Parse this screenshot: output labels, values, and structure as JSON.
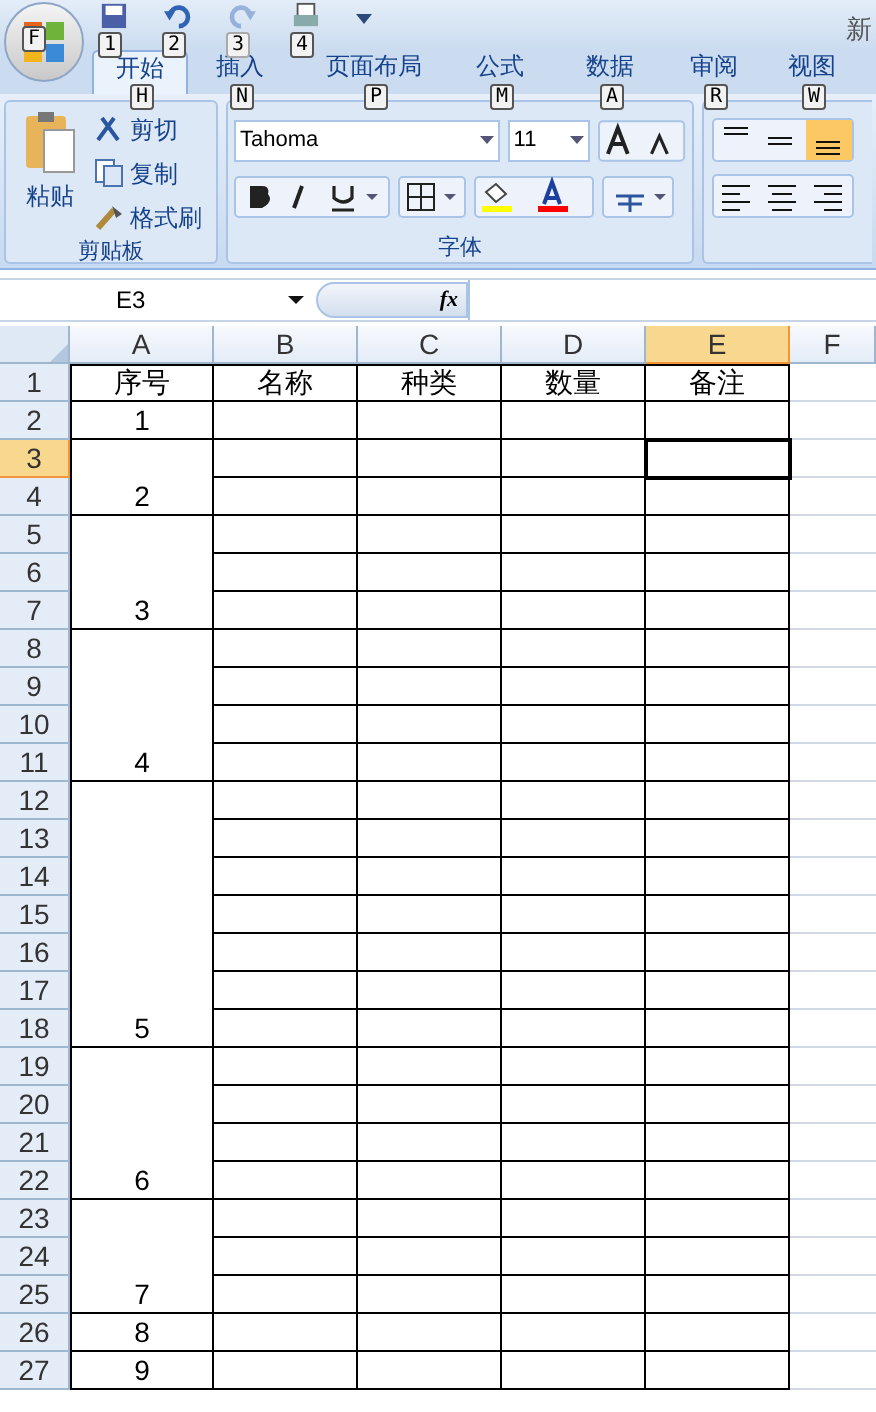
{
  "window": {
    "title": "新"
  },
  "office_button": {
    "keytip": "F"
  },
  "quick_access": [
    {
      "kind": "save",
      "keytip": "1",
      "disabled": false
    },
    {
      "kind": "undo",
      "keytip": "2",
      "disabled": false
    },
    {
      "kind": "redo",
      "keytip": "3",
      "disabled": true
    },
    {
      "kind": "print",
      "keytip": "4",
      "disabled": false
    }
  ],
  "tabs": [
    {
      "label": "开始",
      "keytip": "H",
      "selected": true
    },
    {
      "label": "插入",
      "keytip": "N",
      "selected": false
    },
    {
      "label": "页面布局",
      "keytip": "P",
      "selected": false
    },
    {
      "label": "公式",
      "keytip": "M",
      "selected": false
    },
    {
      "label": "数据",
      "keytip": "A",
      "selected": false
    },
    {
      "label": "审阅",
      "keytip": "R",
      "selected": false
    },
    {
      "label": "视图",
      "keytip": "W",
      "selected": false
    }
  ],
  "clipboard": {
    "label": "剪贴板",
    "paste": "粘贴",
    "items": [
      "剪切",
      "复制",
      "格式刷"
    ]
  },
  "font_group": {
    "label": "字体",
    "font": "Tahoma",
    "size": "11"
  },
  "name_box": "E3",
  "function_button": "fx",
  "sheet": {
    "columns": [
      {
        "label": "A",
        "selected": false
      },
      {
        "label": "B",
        "selected": false
      },
      {
        "label": "C",
        "selected": false
      },
      {
        "label": "D",
        "selected": false
      },
      {
        "label": "E",
        "selected": true
      },
      {
        "label": "F",
        "selected": false
      }
    ],
    "row_numbers": [
      {
        "label": "1",
        "selected": false
      },
      {
        "label": "2",
        "selected": false
      },
      {
        "label": "3",
        "selected": true
      },
      {
        "label": "4",
        "selected": false
      },
      {
        "label": "5",
        "selected": false
      },
      {
        "label": "6",
        "selected": false
      },
      {
        "label": "7",
        "selected": false
      },
      {
        "label": "8",
        "selected": false
      },
      {
        "label": "9",
        "selected": false
      },
      {
        "label": "10",
        "selected": false
      },
      {
        "label": "11",
        "selected": false
      },
      {
        "label": "12",
        "selected": false
      },
      {
        "label": "13",
        "selected": false
      },
      {
        "label": "14",
        "selected": false
      },
      {
        "label": "15",
        "selected": false
      },
      {
        "label": "16",
        "selected": false
      },
      {
        "label": "17",
        "selected": false
      },
      {
        "label": "18",
        "selected": false
      },
      {
        "label": "19",
        "selected": false
      },
      {
        "label": "20",
        "selected": false
      },
      {
        "label": "21",
        "selected": false
      },
      {
        "label": "22",
        "selected": false
      },
      {
        "label": "23",
        "selected": false
      },
      {
        "label": "24",
        "selected": false
      },
      {
        "label": "25",
        "selected": false
      },
      {
        "label": "26",
        "selected": false
      },
      {
        "label": "27",
        "selected": false
      }
    ],
    "header_row": [
      "序号",
      "名称",
      "种类",
      "数量",
      "备注"
    ],
    "column_a": [
      {
        "value": "1",
        "merged_below": false
      },
      {
        "merged_below": true
      },
      {
        "value": "2",
        "merged_below": false
      },
      {
        "merged_below": true
      },
      {
        "merged_below": true
      },
      {
        "value": "3",
        "merged_below": false
      },
      {
        "merged_below": true
      },
      {
        "merged_below": true
      },
      {
        "merged_below": true
      },
      {
        "value": "4",
        "merged_below": false
      },
      {
        "merged_below": true
      },
      {
        "merged_below": true
      },
      {
        "merged_below": true
      },
      {
        "merged_below": true
      },
      {
        "merged_below": true
      },
      {
        "merged_below": true
      },
      {
        "value": "5",
        "merged_below": false
      },
      {
        "merged_below": true
      },
      {
        "merged_below": true
      },
      {
        "merged_below": true
      },
      {
        "value": "6",
        "merged_below": false
      },
      {
        "merged_below": true
      },
      {
        "merged_below": true
      },
      {
        "value": "7",
        "merged_below": false
      },
      {
        "value": "8",
        "merged_below": false
      },
      {
        "value": "9",
        "merged_below": false
      }
    ]
  }
}
